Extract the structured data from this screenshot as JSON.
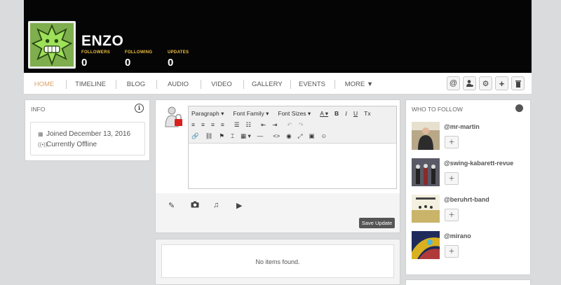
{
  "profile": {
    "name": "ENZO",
    "stats": [
      {
        "label": "FOLLOWERS",
        "value": "0"
      },
      {
        "label": "FOLLOWING",
        "value": "0"
      },
      {
        "label": "UPDATES",
        "value": "0"
      }
    ]
  },
  "nav": {
    "items": [
      "HOME",
      "TIMELINE",
      "BLOG",
      "AUDIO",
      "VIDEO",
      "GALLERY",
      "EVENTS",
      "MORE ▼"
    ],
    "active": "HOME",
    "tools": [
      "at-icon",
      "add-user-icon",
      "gear-icon",
      "plus-icon",
      "trash-icon"
    ]
  },
  "info": {
    "title": "INFO",
    "joined": "Joined December 13, 2016",
    "status": "Currently Offline"
  },
  "composer": {
    "paragraph": "Paragraph",
    "font_family": "Font Family",
    "font_sizes": "Font Sizes",
    "save_label": "Save Update"
  },
  "feed": {
    "empty_text": "No items found."
  },
  "who_to_follow": {
    "title": "WHO TO FOLLOW",
    "users": [
      {
        "handle": "@mr-martin"
      },
      {
        "handle": "@swing-kabarett-revue"
      },
      {
        "handle": "@beruhrt-band"
      },
      {
        "handle": "@mirano"
      }
    ]
  }
}
